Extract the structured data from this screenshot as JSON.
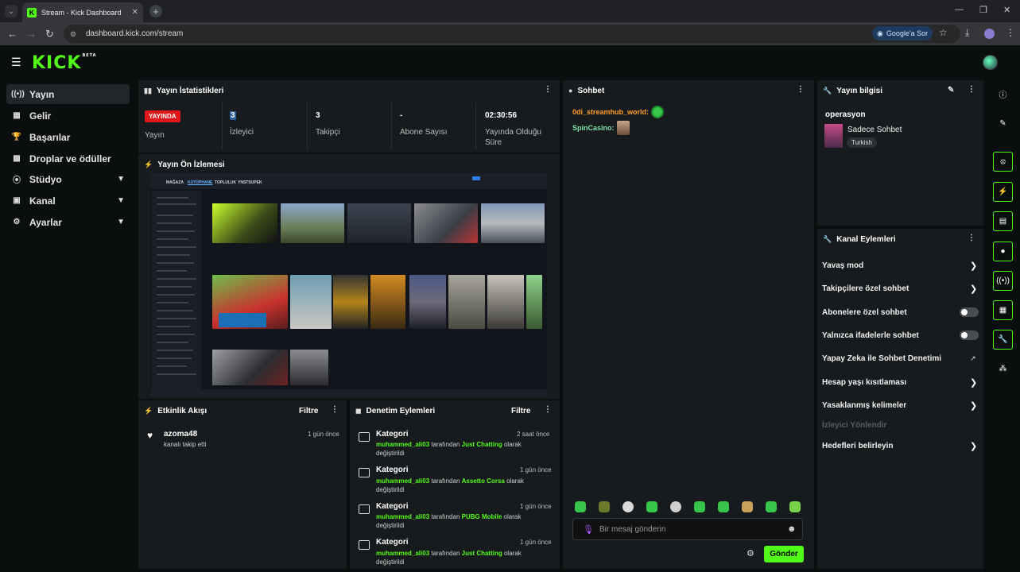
{
  "browser": {
    "tab_title": "Stream - Kick Dashboard",
    "url": "dashboard.kick.com/stream",
    "google_lens": "Google'a Sor"
  },
  "brand": {
    "logo": "KICK",
    "logo_sup": "BETA",
    "accent": "#53fc18"
  },
  "sidebar": {
    "items": [
      {
        "label": "Yayın",
        "icon": "broadcast-icon"
      },
      {
        "label": "Gelir",
        "icon": "income-icon"
      },
      {
        "label": "Başarılar",
        "icon": "trophy-icon"
      },
      {
        "label": "Droplar ve ödüller",
        "icon": "gift-icon"
      },
      {
        "label": "Stüdyo",
        "icon": "studio-icon"
      },
      {
        "label": "Kanal",
        "icon": "channel-icon"
      },
      {
        "label": "Ayarlar",
        "icon": "gear-icon"
      }
    ]
  },
  "stats": {
    "title": "Yayın İstatistikleri",
    "live_badge": "YAYINDA",
    "live_label": "Yayın",
    "viewers_value": "3",
    "viewers_label": "İzleyici",
    "followers_value": "3",
    "followers_label": "Takipçi",
    "subs_value": "-",
    "subs_label": "Abone Sayısı",
    "uptime_value": "02:30:56",
    "uptime_label": "Yayında Olduğu Süre"
  },
  "preview": {
    "title": "Yayın Ön İzlemesi",
    "nav": [
      "MAĞAZA",
      "KÜTÜPHANE",
      "TOPLULUK",
      "YNSTSUPEK"
    ]
  },
  "chat": {
    "title": "Sohbet",
    "messages": [
      {
        "user": "0di_streamhub_world",
        "color": "#ff9e2c"
      },
      {
        "user": "SpinCasino",
        "color": "#7ee0a8"
      }
    ],
    "placeholder": "Bir mesaj gönderin",
    "send": "Gönder"
  },
  "stream_info": {
    "title": "Yayın bilgisi",
    "stream_title": "operasyon",
    "category": "Sadece Sohbet",
    "tag": "Turkish"
  },
  "channel_actions": {
    "title": "Kanal Eylemleri",
    "items": [
      "Yavaş mod",
      "Takipçilere özel sohbet",
      "Abonelere özel sohbet",
      "Yalnızca ifadelerle sohbet",
      "Yapay Zeka ile Sohbet Denetimi",
      "Hesap yaşı kısıtlaması",
      "Yasaklanmış kelimeler",
      "İzleyici Yönlendir",
      "Hedefleri belirleyin"
    ]
  },
  "activity": {
    "title": "Etkinlik Akışı",
    "filter": "Filtre",
    "items": [
      {
        "user": "azoma48",
        "desc": "kanalı takip etti",
        "time": "1 gün önce"
      }
    ]
  },
  "mod_actions": {
    "title": "Denetim Eylemleri",
    "filter": "Filtre",
    "items": [
      {
        "title": "Kategori",
        "user": "muhammed_ali03",
        "mid": "tarafından",
        "game": "Just Chatting",
        "end": "olarak",
        "end2": "değiştirildi",
        "time": "2 saat önce"
      },
      {
        "title": "Kategori",
        "user": "muhammed_ali03",
        "mid": "tarafından",
        "game": "Assetto Corsa",
        "end": "olarak",
        "end2": "değiştirildi",
        "time": "1 gün önce"
      },
      {
        "title": "Kategori",
        "user": "muhammed_ali03",
        "mid": "tarafından",
        "game": "PUBG Mobile",
        "end": "olarak",
        "end2": "değiştirildi",
        "time": "1 gün önce"
      },
      {
        "title": "Kategori",
        "user": "muhammed_ali03",
        "mid": "tarafından",
        "game": "Just Chatting",
        "end": "olarak",
        "end2": "değiştirildi",
        "time": "1 gün önce"
      }
    ]
  }
}
